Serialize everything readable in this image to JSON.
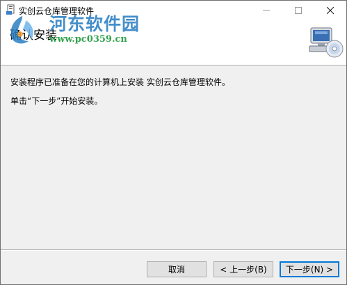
{
  "window": {
    "title": "实创云仓库管理软件"
  },
  "titlebar": {
    "icons": {
      "app": "installer-app-icon",
      "minimize": "minimize-icon",
      "maximize": "maximize-icon",
      "close": "close-icon"
    }
  },
  "banner": {
    "heading": "确认安装",
    "graphic_icon": "computer-cd-icon"
  },
  "watermark": {
    "name": "河东软件园",
    "url": "www.pc0359.cn",
    "logo_icon": "pc0359-logo-icon"
  },
  "content": {
    "line1": "安装程序已准备在您的计算机上安装 实创云仓库管理软件。",
    "line2": "单击“下一步”开始安装。"
  },
  "buttons": {
    "cancel": "取消",
    "back": "< 上一步(B)",
    "next": "下一步(N) >"
  },
  "colors": {
    "accent_focus": "#0078d7",
    "watermark_blue": "#2b7fc3",
    "watermark_green": "#1e9a3a"
  }
}
